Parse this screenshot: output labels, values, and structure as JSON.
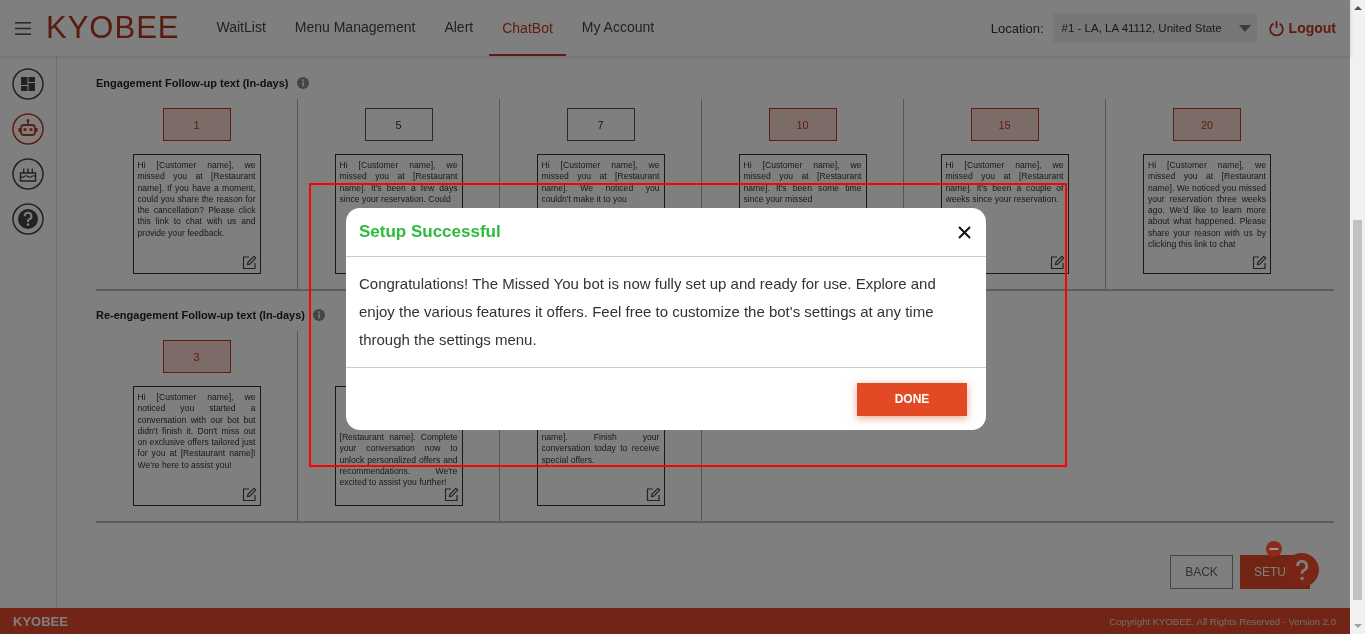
{
  "header": {
    "logo": "KYOBEE",
    "nav": [
      {
        "label": "WaitList",
        "selected": false
      },
      {
        "label": "Menu Management",
        "selected": false
      },
      {
        "label": "Alert",
        "selected": false
      },
      {
        "label": "ChatBot",
        "selected": true
      },
      {
        "label": "My Account",
        "selected": false
      }
    ],
    "location_label": "Location:",
    "location_value": "#1 - LA, LA 41112, United State",
    "logout": "Logout"
  },
  "sidebar": {
    "items": [
      {
        "kind": "dashboard",
        "selected": false
      },
      {
        "kind": "robot",
        "selected": true
      },
      {
        "kind": "cake",
        "selected": false
      },
      {
        "kind": "help",
        "selected": false
      }
    ]
  },
  "sections": [
    {
      "title": "Engagement Follow-up text (In-days)",
      "columns": [
        {
          "day": "1",
          "selected": true,
          "text": "Hi [Customer name], we missed you at [Restaurant name]. If you have a moment, could you share the reason for the cancellation? Please click this link to chat with us and provide your feedback.",
          "covered_top": false,
          "edit_icon": true
        },
        {
          "day": "5",
          "selected": false,
          "text": "Hi [Customer name], we missed you at [Restaurant name]. It's been a few days since your reservation. Could",
          "covered_top": false,
          "edit_icon": false
        },
        {
          "day": "7",
          "selected": false,
          "text": "Hi [Customer name], we missed you at [Restaurant name]. We noticed you couldn't make it to you",
          "covered_top": false,
          "edit_icon": false
        },
        {
          "day": "10",
          "selected": true,
          "text": "Hi [Customer name], we missed you at [Restaurant name]. It's been some time since your missed",
          "covered_top": false,
          "edit_icon": false
        },
        {
          "day": "15",
          "selected": true,
          "text": "Hi [Customer name], we missed you at [Restaurant name]. It's been a couple of weeks since your reservation.",
          "covered_top": false,
          "edit_icon": true
        },
        {
          "day": "20",
          "selected": true,
          "text": "Hi [Customer name], we missed you at [Restaurant name]. We noticed you missed your reservation three weeks ago. We'd like to learn more about what happened. Please share your reason with us by clicking this link to chat",
          "covered_top": false,
          "edit_icon": true
        }
      ]
    },
    {
      "title": "Re-engagement Follow-up text (In-days)",
      "columns": [
        {
          "day": "3",
          "selected": true,
          "text": "Hi [Customer name], we noticed you started a conversation with our bot but didn't finish it. Don't miss out on exclusive offers tailored just for you at [Restaurant name]! We're here to assist you!",
          "covered_top": false,
          "edit_icon": true
        },
        {
          "text": "[Restaurant name]. Complete your conversation now to unlock personalized offers and recommendations. We're excited to assist you further!",
          "covered_top": true,
          "edit_icon": true
        },
        {
          "text": "name]. Finish your conversation today to receive special offers.",
          "covered_top": true,
          "edit_icon": true
        }
      ]
    }
  ],
  "buttons": [
    {
      "label": "BACK",
      "kind": "outline"
    },
    {
      "label": "SETU",
      "kind": "primary"
    }
  ],
  "footer": {
    "brand": "KYOBEE",
    "copyright": "Copyright KYOBEE. All Rights Reserved - Version 2.0"
  },
  "dialog": {
    "title": "Setup Successful",
    "message": "Congratulations! The Missed You bot is now fully set up and ready for use. Explore and enjoy the various features it offers. Feel free to customize the bot's settings at any time through the settings menu.",
    "button": "DONE"
  }
}
